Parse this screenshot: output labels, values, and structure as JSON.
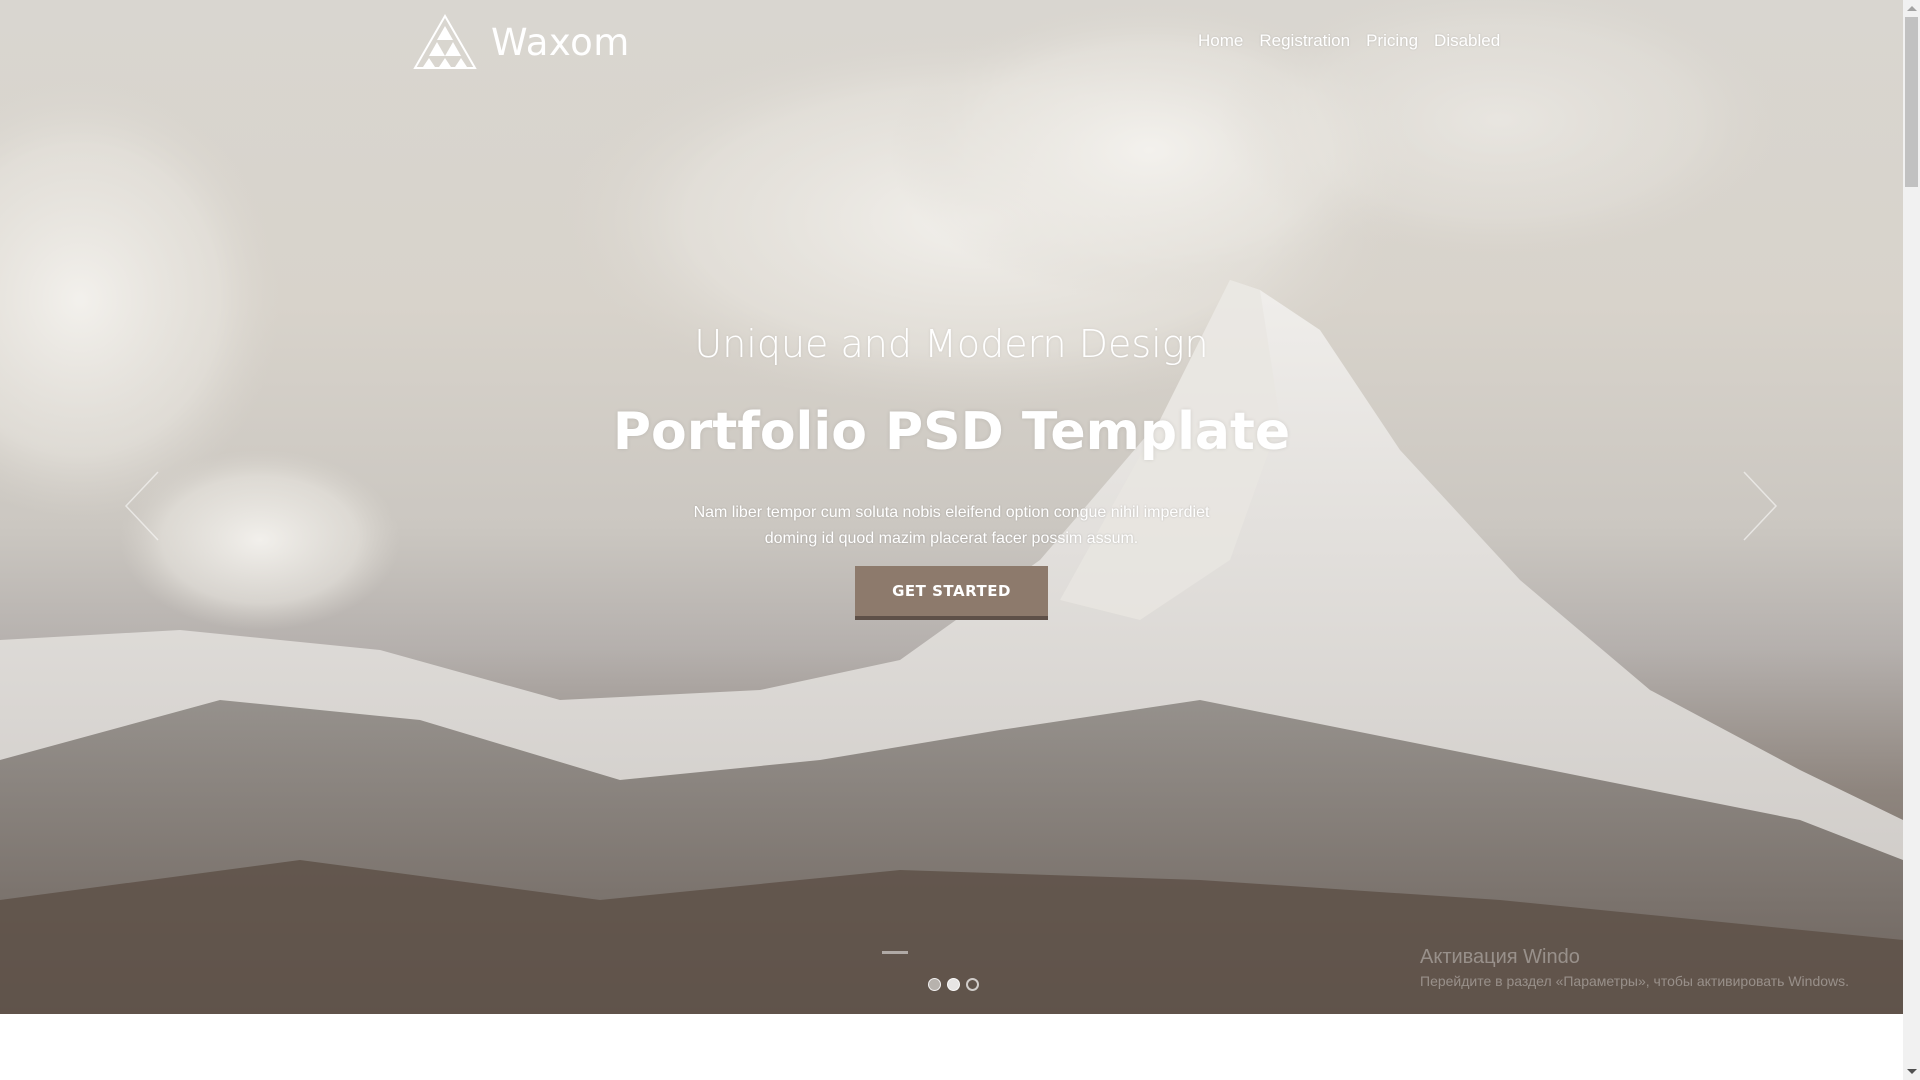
{
  "brand": {
    "name": "Waxom"
  },
  "nav": {
    "items": [
      {
        "label": "Home"
      },
      {
        "label": "Registration"
      },
      {
        "label": "Pricing"
      },
      {
        "label": "Disabled"
      }
    ]
  },
  "hero": {
    "subtitle": "Unique and Modern Design",
    "title": "Portfolio PSD Template",
    "description_line1": "Nam liber tempor cum soluta nobis eleifend option congue nihil imperdiet",
    "description_line2": "doming id quod mazim placerat facer possim assum.",
    "cta_label": "GET STARTED",
    "slide_count": 3,
    "active_slide": 2
  },
  "icons": {
    "logo": "triangle-logo-icon",
    "prev": "chevron-left-icon",
    "next": "chevron-right-icon"
  },
  "watermark": {
    "line1": "Активация Windo",
    "line2": "Перейдите в раздел «Параметры», чтобы активировать Windows."
  },
  "colors": {
    "cta_background": "#8d7a6c",
    "cta_border": "#5e5048",
    "text": "#ffffff"
  }
}
